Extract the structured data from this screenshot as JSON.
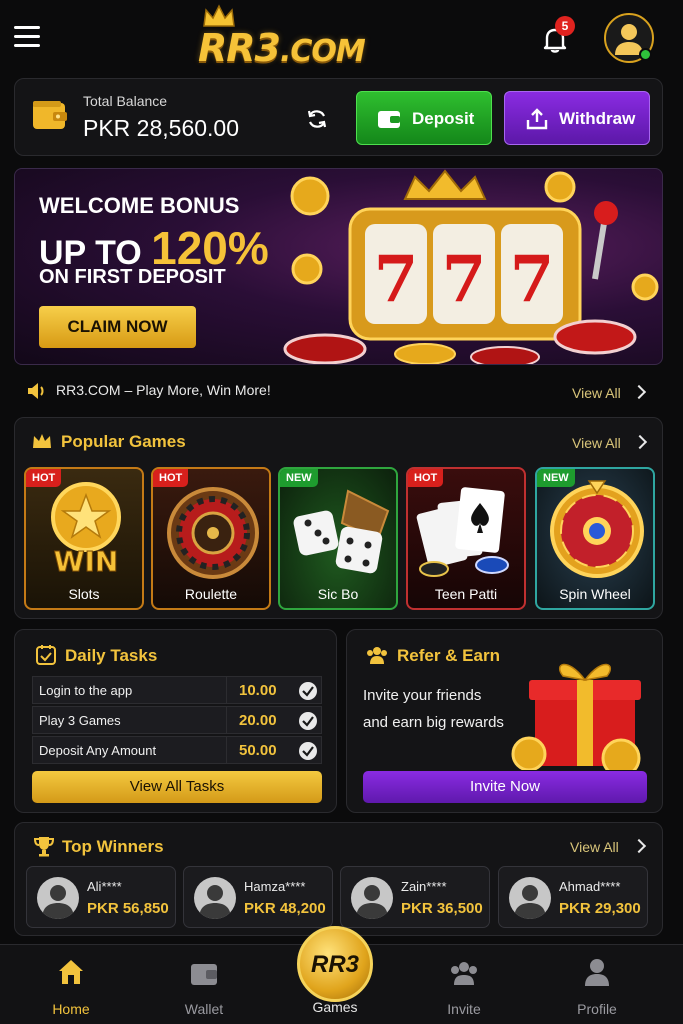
{
  "header": {
    "logo": "RR3",
    "logo_domain": ".COM",
    "notification_count": "5"
  },
  "balance": {
    "label": "Total Balance",
    "amount": "PKR 28,560.00",
    "deposit_label": "Deposit",
    "withdraw_label": "Withdraw"
  },
  "banner": {
    "line1": "WELCOME BONUS",
    "line2_prefix": "UP TO ",
    "line2_value": "120%",
    "line3": "ON FIRST DEPOSIT",
    "cta": "CLAIM NOW"
  },
  "marquee": {
    "text": "RR3.COM – Play More, Win More!",
    "view_all": "View All"
  },
  "popular": {
    "title": "Popular Games",
    "view_all": "View All",
    "games": [
      {
        "name": "Slots",
        "tag": "HOT"
      },
      {
        "name": "Roulette",
        "tag": "HOT"
      },
      {
        "name": "Sic Bo",
        "tag": "NEW"
      },
      {
        "name": "Teen Patti",
        "tag": "HOT"
      },
      {
        "name": "Spin Wheel",
        "tag": "NEW"
      }
    ],
    "slots_art_text": "WIN"
  },
  "tasks": {
    "title": "Daily Tasks",
    "items": [
      {
        "name": "Login to the app",
        "reward": "10.00"
      },
      {
        "name": "Play 3 Games",
        "reward": "20.00"
      },
      {
        "name": "Deposit Any Amount",
        "reward": "50.00"
      }
    ],
    "button": "View All Tasks"
  },
  "refer": {
    "title": "Refer & Earn",
    "desc_line1": "Invite your friends",
    "desc_line2": "and earn big rewards",
    "button": "Invite Now"
  },
  "winners": {
    "title": "Top Winners",
    "view_all": "View All",
    "items": [
      {
        "name": "Ali****",
        "amount": "PKR 56,850"
      },
      {
        "name": "Hamza****",
        "amount": "PKR 48,200"
      },
      {
        "name": "Zain****",
        "amount": "PKR 36,500"
      },
      {
        "name": "Ahmad****",
        "amount": "PKR 29,300"
      }
    ]
  },
  "nav": {
    "home": "Home",
    "wallet": "Wallet",
    "games_badge": "RR3",
    "games": "Games",
    "invite": "Invite",
    "profile": "Profile"
  },
  "colors": {
    "gold": "#f2c33d",
    "deposit_green": "#1fa526",
    "withdraw_purple": "#7a24d4",
    "hot_red": "#d8201c",
    "new_green": "#1e9c2e"
  }
}
